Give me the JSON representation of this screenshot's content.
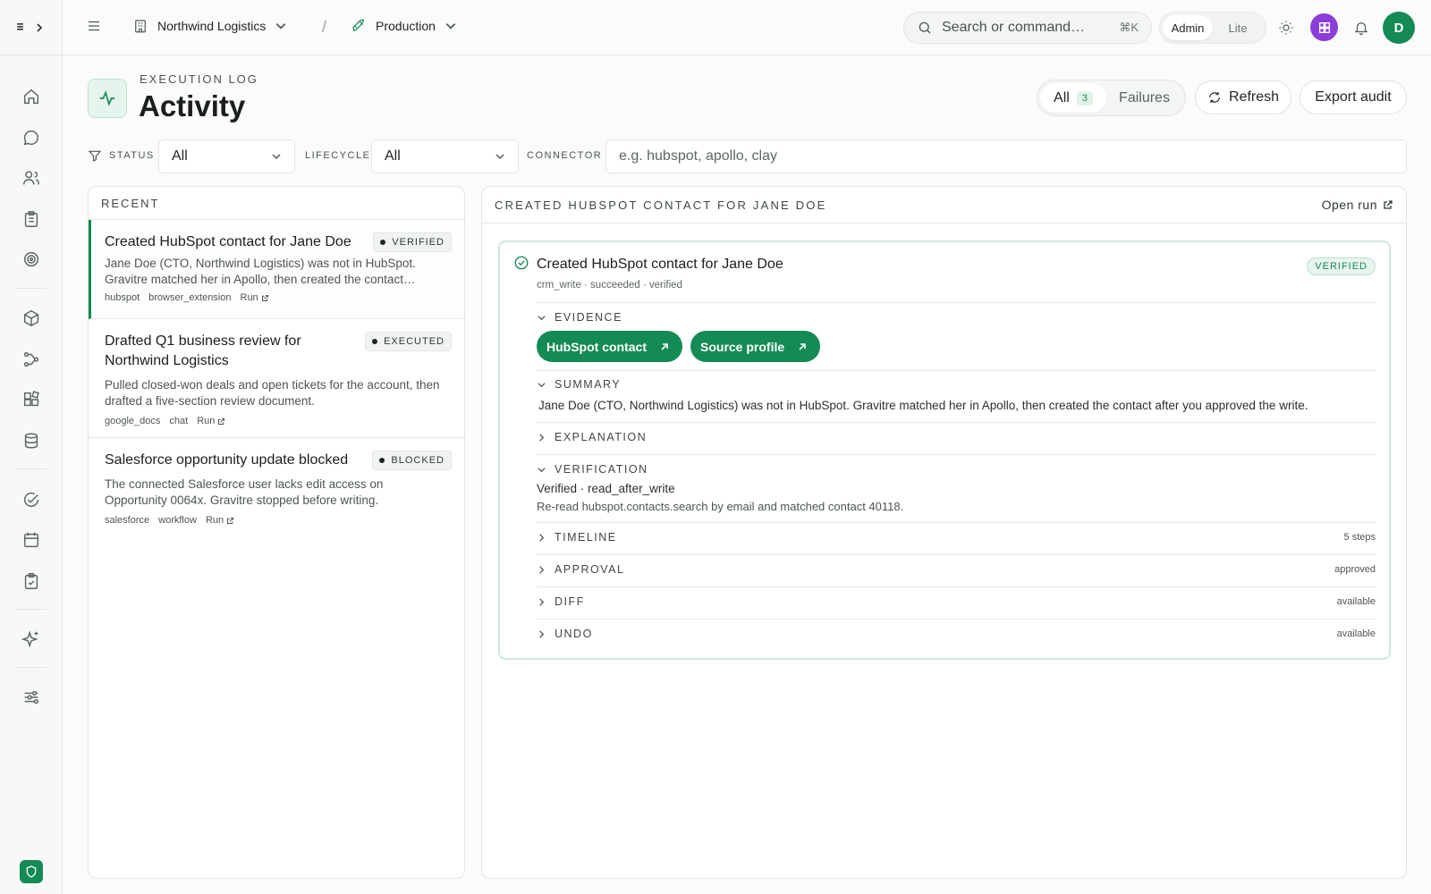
{
  "sidebar": {
    "logo": "≡"
  },
  "header": {
    "workspace": "Northwind Logistics",
    "separator": "/",
    "environment": "Production",
    "search_placeholder": "Search or command…",
    "shortcut": "⌘K",
    "mode_admin": "Admin",
    "mode_lite": "Lite",
    "avatar_initial": "D"
  },
  "page": {
    "eyebrow": "EXECUTION LOG",
    "title": "Activity",
    "seg_all": "All",
    "seg_all_count": "3",
    "seg_failures": "Failures",
    "refresh_label": "Refresh",
    "export_label": "Export audit"
  },
  "filters": {
    "status_label": "STATUS",
    "status_value": "All",
    "lifecycle_label": "LIFECYCLE",
    "lifecycle_value": "All",
    "connector_label": "CONNECTOR",
    "connector_placeholder": "e.g. hubspot, apollo, clay"
  },
  "recent": {
    "header": "RECENT",
    "items": [
      {
        "title": "Created HubSpot contact for Jane Doe",
        "status": "VERIFIED",
        "desc": "Jane Doe (CTO, Northwind Logistics) was not in HubSpot.",
        "desc2": "Gravitre matched her in Apollo, then created the contact…",
        "tags": [
          "hubspot",
          "browser_extension"
        ],
        "run": "Run"
      },
      {
        "title": "Drafted Q1 business review for Northwind Logistics",
        "status": "EXECUTED",
        "desc": "Pulled closed-won deals and open tickets for the account, then drafted a five-section review document.",
        "tags": [
          "google_docs",
          "chat"
        ],
        "run": "Run"
      },
      {
        "title": "Salesforce opportunity update blocked",
        "status": "BLOCKED",
        "desc": "The connected Salesforce user lacks edit access on Opportunity 0064x. Gravitre stopped before writing.",
        "tags": [
          "salesforce",
          "workflow"
        ],
        "run": "Run"
      }
    ]
  },
  "detail": {
    "header": "CREATED HUBSPOT CONTACT FOR JANE DOE",
    "open_run": "Open run",
    "card": {
      "title": "Created HubSpot contact for Jane Doe",
      "meta": "crm_write · succeeded · verified",
      "badge": "VERIFIED",
      "evidence_label": "EVIDENCE",
      "evidence_buttons": [
        "HubSpot contact",
        "Source profile"
      ],
      "summary_label": "SUMMARY",
      "summary_text": "Jane Doe (CTO, Northwind Logistics) was not in HubSpot. Gravitre matched her in Apollo, then created the contact after you approved the write.",
      "explanation_label": "EXPLANATION",
      "verification_label": "VERIFICATION",
      "verification_line1": "Verified · read_after_write",
      "verification_line2": "Re-read hubspot.contacts.search by email and matched contact 40118.",
      "timeline_label": "TIMELINE",
      "timeline_meta": "5 steps",
      "approval_label": "APPROVAL",
      "approval_meta": "approved",
      "diff_label": "DIFF",
      "diff_meta": "available",
      "undo_label": "UNDO",
      "undo_meta": "available"
    }
  },
  "colors": {
    "accent": "#148a55",
    "app_tile": "#8b3ed9"
  }
}
